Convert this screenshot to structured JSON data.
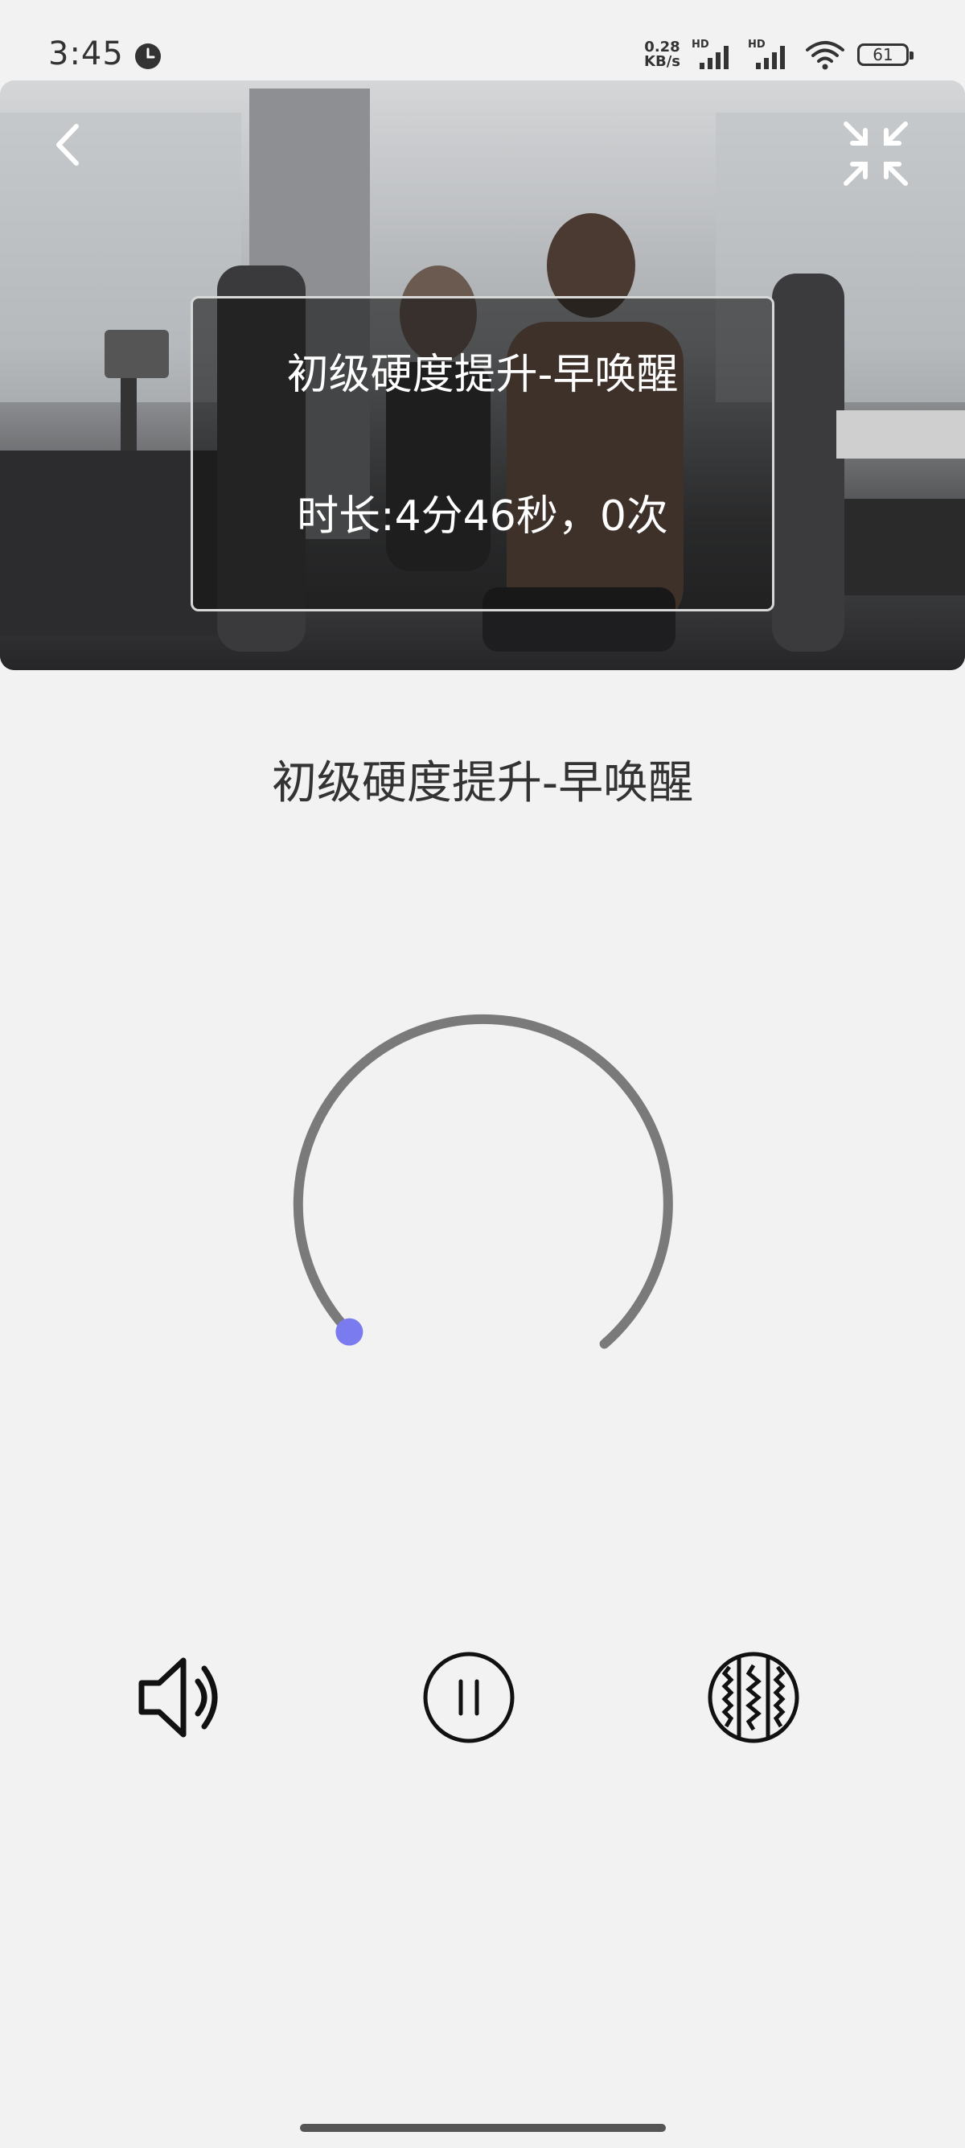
{
  "status_bar": {
    "time": "3:45",
    "net_speed_value": "0.28",
    "net_speed_unit": "KB/s",
    "sim1_label": "HD",
    "sim2_label": "HD",
    "battery_level": "61"
  },
  "player": {
    "overlay_title": "初级硬度提升-早唤醒",
    "overlay_meta": "时长:4分46秒，0次",
    "back_icon": "chevron-left-icon",
    "fullscreen_icon": "collapse-arrows-icon"
  },
  "course": {
    "title": "初级硬度提升-早唤醒"
  },
  "dial": {
    "progress": 0,
    "track_color": "#7a7a7a",
    "knob_color": "#7b7bf0"
  },
  "controls": {
    "volume_icon": "speaker-icon",
    "pause_icon": "pause-icon",
    "vibration_icon": "vibration-mode-icon"
  }
}
